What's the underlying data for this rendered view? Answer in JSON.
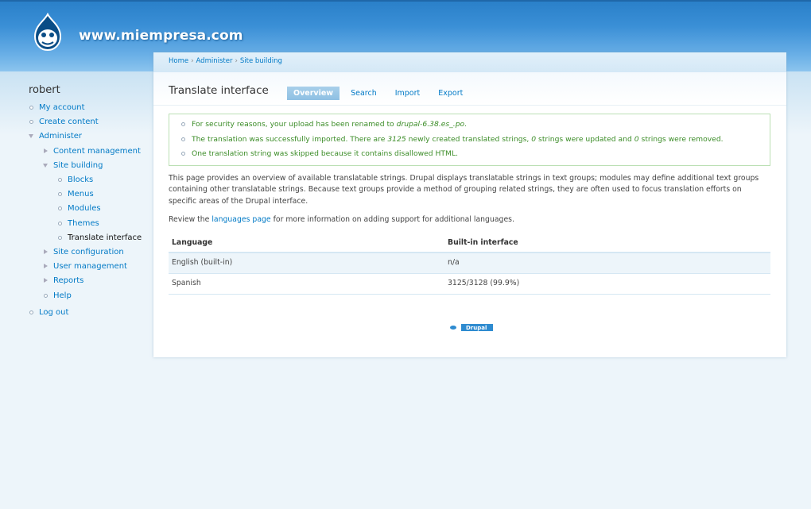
{
  "header": {
    "site_name": "www.miempresa.com"
  },
  "breadcrumb": [
    "Home",
    "Administer",
    "Site building"
  ],
  "sidebar": {
    "user": "robert",
    "items": [
      {
        "label": "My account"
      },
      {
        "label": "Create content"
      },
      {
        "label": "Administer"
      },
      {
        "label": "Content management"
      },
      {
        "label": "Site building"
      },
      {
        "label": "Blocks"
      },
      {
        "label": "Menus"
      },
      {
        "label": "Modules"
      },
      {
        "label": "Themes"
      },
      {
        "label": "Translate interface"
      },
      {
        "label": "Site configuration"
      },
      {
        "label": "User management"
      },
      {
        "label": "Reports"
      },
      {
        "label": "Help"
      },
      {
        "label": "Log out"
      }
    ]
  },
  "page": {
    "title": "Translate interface",
    "tabs": [
      "Overview",
      "Search",
      "Import",
      "Export"
    ]
  },
  "messages": {
    "m1_pre": "For security reasons, your upload has been renamed to ",
    "m1_file": "drupal-6.38.es_.po",
    "m1_post": ".",
    "m2_a": "The translation was successfully imported. There are ",
    "m2_n1": "3125",
    "m2_b": " newly created translated strings, ",
    "m2_n2": "0",
    "m2_c": " strings were updated and ",
    "m2_n3": "0",
    "m2_d": " strings were removed.",
    "m3": "One translation string was skipped because it contains disallowed HTML."
  },
  "content": {
    "intro": "This page provides an overview of available translatable strings. Drupal displays translatable strings in text groups; modules may define additional text groups containing other translatable strings. Because text groups provide a method of grouping related strings, they are often used to focus translation efforts on specific areas of the Drupal interface.",
    "review_pre": "Review the ",
    "review_link": "languages page",
    "review_post": " for more information on adding support for additional languages."
  },
  "table": {
    "headers": [
      "Language",
      "Built-in interface"
    ],
    "rows": [
      [
        "English (built-in)",
        "n/a"
      ],
      [
        "Spanish",
        "3125/3128 (99.9%)"
      ]
    ]
  },
  "footer": {
    "badge_label": "Drupal"
  },
  "colors": {
    "link": "#027ac6",
    "status_green": "#3b8c27",
    "header_blue": "#3a8fd6"
  }
}
